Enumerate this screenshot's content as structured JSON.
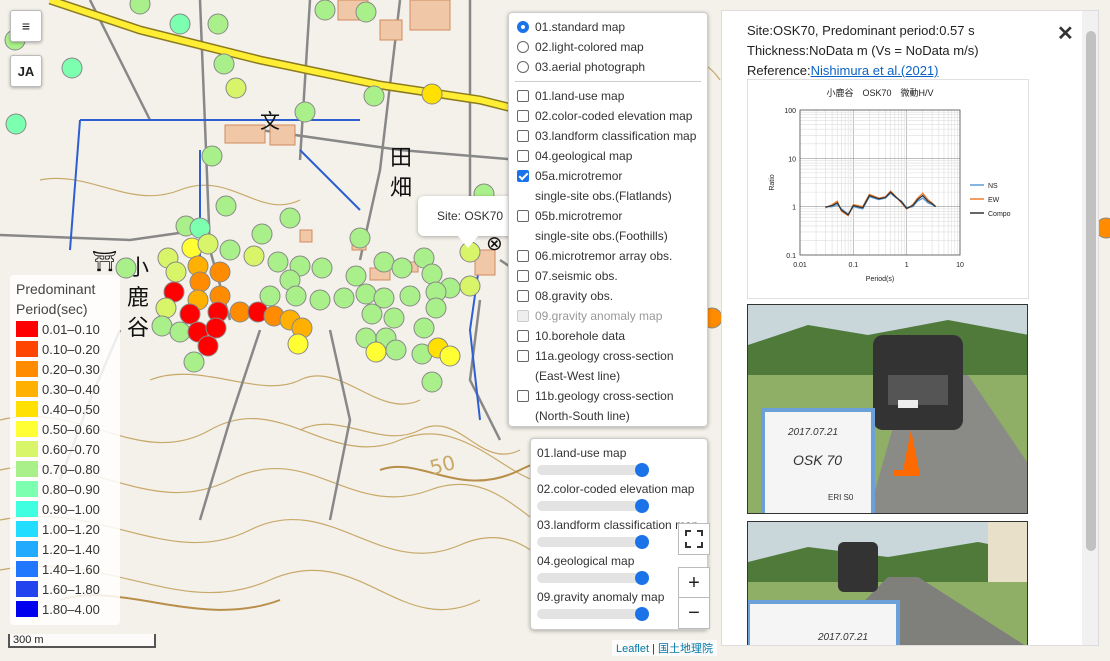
{
  "controls": {
    "menu_icon": "≡",
    "lang": "JA"
  },
  "legend": {
    "title_line1": "Predominant",
    "title_line2": "Period(sec)",
    "items": [
      {
        "label": "0.01–0.10",
        "color": "#ff0000"
      },
      {
        "label": "0.10–0.20",
        "color": "#ff4500"
      },
      {
        "label": "0.20–0.30",
        "color": "#ff8c00"
      },
      {
        "label": "0.30–0.40",
        "color": "#ffb000"
      },
      {
        "label": "0.40–0.50",
        "color": "#ffe000"
      },
      {
        "label": "0.50–0.60",
        "color": "#ffff33"
      },
      {
        "label": "0.60–0.70",
        "color": "#d8f56a"
      },
      {
        "label": "0.70–0.80",
        "color": "#aaf08a"
      },
      {
        "label": "0.80–0.90",
        "color": "#7dffb0"
      },
      {
        "label": "0.90–1.00",
        "color": "#40ffe0"
      },
      {
        "label": "1.00–1.20",
        "color": "#22ddff"
      },
      {
        "label": "1.20–1.40",
        "color": "#22aaff"
      },
      {
        "label": "1.40–1.60",
        "color": "#2277ff"
      },
      {
        "label": "1.60–1.80",
        "color": "#2244ee"
      },
      {
        "label": "1.80–4.00",
        "color": "#0000ee"
      }
    ]
  },
  "scale": "300 m",
  "basemaps": [
    {
      "label": "01.standard map",
      "checked": true
    },
    {
      "label": "02.light-colored map",
      "checked": false
    },
    {
      "label": "03.aerial photograph",
      "checked": false
    }
  ],
  "overlays": [
    {
      "label": "01.land-use map",
      "checked": false,
      "disabled": false
    },
    {
      "label": "02.color-coded elevation map",
      "checked": false,
      "disabled": false
    },
    {
      "label": "03.landform classification map",
      "checked": false,
      "disabled": false
    },
    {
      "label": "04.geological map",
      "checked": false,
      "disabled": false
    },
    {
      "label": "05a.microtremor",
      "label2": "single-site obs.(Flatlands)",
      "checked": true,
      "disabled": false
    },
    {
      "label": "05b.microtremor",
      "label2": "single-site obs.(Foothills)",
      "checked": false,
      "disabled": false
    },
    {
      "label": "06.microtremor array obs.",
      "checked": false,
      "disabled": false
    },
    {
      "label": "07.seismic obs.",
      "checked": false,
      "disabled": false
    },
    {
      "label": "08.gravity obs.",
      "checked": false,
      "disabled": false
    },
    {
      "label": "09.gravity anomaly map",
      "checked": false,
      "disabled": true
    },
    {
      "label": "10.borehole data",
      "checked": false,
      "disabled": false
    },
    {
      "label": "11a.geology cross-section",
      "label2": "(East-West line)",
      "checked": false,
      "disabled": false
    },
    {
      "label": "11b.geology cross-section",
      "label2": "(North-South line)",
      "checked": false,
      "disabled": false
    }
  ],
  "opacity": [
    {
      "label": "01.land-use map",
      "value": 1.0
    },
    {
      "label": "02.color-coded elevation map",
      "value": 1.0
    },
    {
      "label": "03.landform classification map",
      "value": 1.0
    },
    {
      "label": "04.geological map",
      "value": 1.0
    },
    {
      "label": "09.gravity anomaly map",
      "value": 1.0
    }
  ],
  "zoom": {
    "in": "+",
    "out": "−",
    "fullscreen_icon": "fullscreen-icon"
  },
  "tooltip": "Site: OSK70",
  "map_labels": {
    "kanji1": "田",
    "kanji2": "畑",
    "kanji3": "小",
    "kanji4": "鹿",
    "kanji5": "谷",
    "contour": "50"
  },
  "info": {
    "line1": "Site:OSK70, Predominant period:0.57 s",
    "line2": "Thickness:NoData m (Vs = NoData m/s)",
    "ref_prefix": "Reference:",
    "ref_link": "Nishimura et al.(2021)",
    "close": "✕"
  },
  "chart_data": {
    "type": "line",
    "title": "小鹿谷　OSK70　微動H/V",
    "xlabel": "Period(s)",
    "ylabel": "Ratio",
    "xscale": "log",
    "yscale": "log",
    "xlim": [
      0.01,
      10
    ],
    "ylim": [
      0.1,
      100
    ],
    "xticks": [
      "0.01",
      "0.1",
      "1",
      "10"
    ],
    "yticks": [
      "100",
      "10",
      "1",
      "0.1"
    ],
    "legend_position": "right",
    "x": [
      0.03,
      0.04,
      0.05,
      0.06,
      0.08,
      0.1,
      0.15,
      0.2,
      0.3,
      0.4,
      0.5,
      0.6,
      0.8,
      1.0,
      1.3,
      1.6,
      2.0,
      2.5,
      3.0,
      3.5
    ],
    "series": [
      {
        "name": "NS",
        "color": "#5b9bd5",
        "values": [
          1.0,
          1.0,
          1.1,
          0.9,
          0.7,
          1.0,
          0.9,
          1.6,
          1.4,
          1.5,
          1.9,
          1.6,
          1.3,
          0.95,
          1.0,
          1.3,
          1.5,
          1.2,
          1.1,
          1.0
        ]
      },
      {
        "name": "EW",
        "color": "#ed7d31",
        "values": [
          0.95,
          1.1,
          1.3,
          0.8,
          0.65,
          1.1,
          1.0,
          1.8,
          1.5,
          1.6,
          2.1,
          1.7,
          1.2,
          0.9,
          1.1,
          1.5,
          1.9,
          1.4,
          1.2,
          1.0
        ]
      },
      {
        "name": "Compo",
        "color": "#333333",
        "values": [
          0.98,
          1.05,
          1.2,
          0.85,
          0.68,
          1.05,
          0.95,
          1.7,
          1.45,
          1.55,
          2.0,
          1.65,
          1.25,
          0.92,
          1.05,
          1.4,
          1.7,
          1.3,
          1.15,
          1.0
        ]
      }
    ]
  },
  "photo1_board": {
    "date": "2017.07.21",
    "site": "OSK 70",
    "note": "ERI S0"
  },
  "photo2_board": {
    "date": "2017.07.21"
  },
  "attribution": {
    "leaflet": "Leaflet",
    "sep": " | ",
    "gsi": "国土地理院"
  }
}
